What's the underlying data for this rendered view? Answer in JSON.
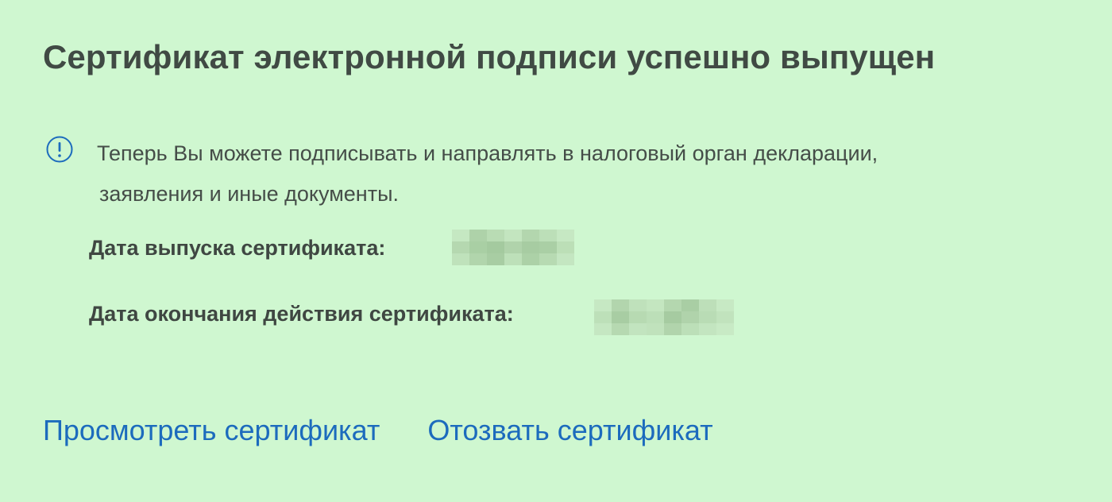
{
  "page": {
    "title": "Сертификат электронной подписи успешно выпущен"
  },
  "notice": {
    "icon": "info-exclamation-icon",
    "line1": "Теперь Вы можете подписывать и направлять в налоговый орган декларации,",
    "line2": "заявления и иные документы."
  },
  "certificate": {
    "issue_date_label": "Дата выпуска сертификата:",
    "expiry_date_label": "Дата окончания действия сертификата:"
  },
  "actions": {
    "view_label": "Просмотреть сертификат",
    "revoke_label": "Отозвать сертификат"
  },
  "colors": {
    "background": "#cff7d0",
    "text": "#404a44",
    "link": "#1c6bbd",
    "icon": "#1c6bbd"
  }
}
